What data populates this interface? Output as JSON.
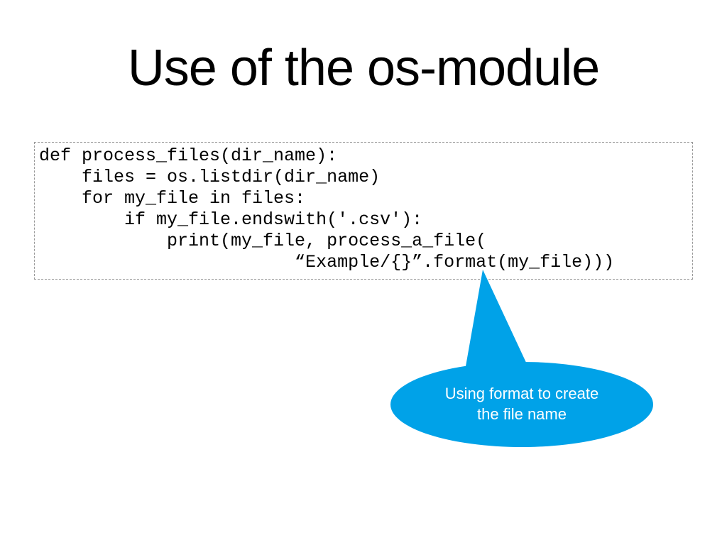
{
  "title": "Use of the os-module",
  "code": {
    "l1": "def process_files(dir_name):",
    "l2": "    files = os.listdir(dir_name)",
    "l3": "    for my_file in files:",
    "l4": "        if my_file.endswith('.csv'):",
    "l5": "            print(my_file, process_a_file(",
    "l6": "                        “Example/{}”.format(my_file)))"
  },
  "callout": {
    "line1": "Using format to create",
    "line2": "the file name"
  },
  "colors": {
    "accent": "#00a2e8"
  }
}
